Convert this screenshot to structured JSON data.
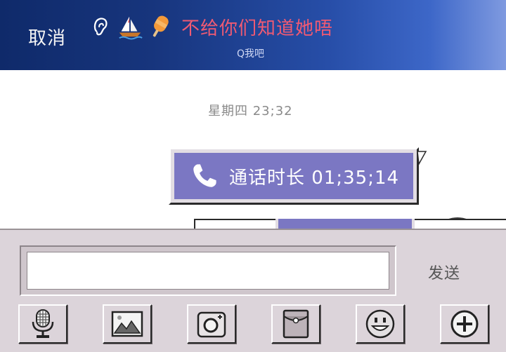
{
  "header": {
    "cancel_label": "取消",
    "nickname": "不给你们知道她唔",
    "subtitle": "Q我吧",
    "emoji_icons": [
      "ear-icon",
      "sailboat-icon",
      "popsicle-icon"
    ]
  },
  "chat": {
    "timestamp": "星期四 23;32",
    "messages": [
      {
        "type": "call",
        "icon": "phone-icon",
        "text": "通话时长 01;35;14",
        "from": "self"
      }
    ]
  },
  "input_panel": {
    "input_value": "",
    "input_placeholder": "",
    "send_label": "发送",
    "toolbar_icons": [
      "microphone-icon",
      "image-icon",
      "camera-icon",
      "red-packet-icon",
      "emoji-icon",
      "plus-icon"
    ]
  },
  "colors": {
    "header_gradient_start": "#0f2a6a",
    "header_gradient_end": "#7f9ae0",
    "nickname": "#f05a73",
    "bubble": "#7b77c3",
    "panel": "#dcd4da"
  }
}
